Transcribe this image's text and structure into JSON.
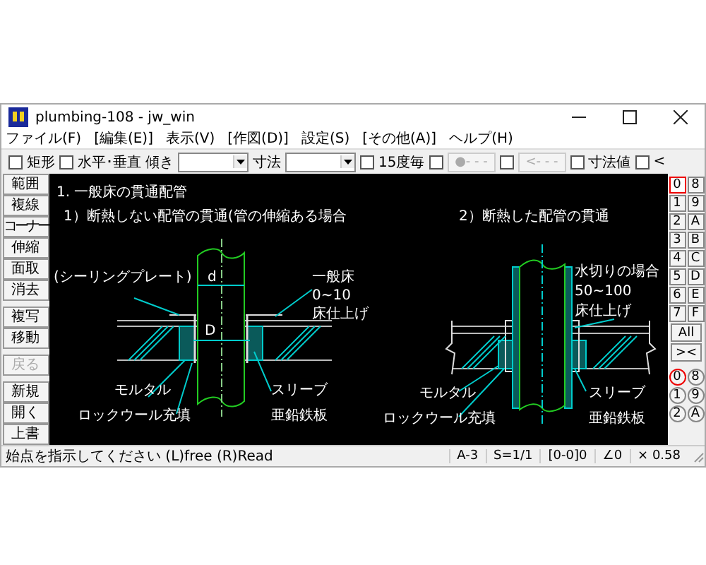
{
  "window": {
    "title": "plumbing-108 - jw_win"
  },
  "menu": [
    "ファイル(F)",
    "[編集(E)]",
    "表示(V)",
    "[作図(D)]",
    "設定(S)",
    "[その他(A)]",
    "ヘルプ(H)"
  ],
  "toolbar": [
    {
      "kind": "checkbox",
      "label": "矩形",
      "checked": false
    },
    {
      "kind": "checkbox",
      "label": "水平･垂直",
      "checked": false
    },
    {
      "kind": "combo",
      "label": "傾き"
    },
    {
      "kind": "combo",
      "label": "寸法"
    },
    {
      "kind": "checkbox",
      "label": "15度毎",
      "checked": false
    },
    {
      "kind": "checkbox",
      "checked": false
    },
    {
      "kind": "button",
      "label": "●- - -",
      "disabled": true
    },
    {
      "kind": "checkbox",
      "checked": false
    },
    {
      "kind": "button",
      "label": "<- - -",
      "disabled": true
    },
    {
      "kind": "checkbox",
      "label": "寸法値",
      "checked": false
    },
    {
      "kind": "checkbox",
      "label": "<",
      "checked": false
    }
  ],
  "left_tools": [
    {
      "label": "範囲",
      "disabled": false
    },
    {
      "label": "複線",
      "disabled": false
    },
    {
      "label": "コーナー",
      "disabled": false
    },
    {
      "label": "伸縮",
      "disabled": false
    },
    {
      "label": "面取",
      "disabled": false
    },
    {
      "label": "消去",
      "disabled": false
    },
    {
      "label": "複写",
      "disabled": false
    },
    {
      "label": "移動",
      "disabled": false
    },
    {
      "label": "戻る",
      "disabled": true
    },
    {
      "label": "新規",
      "disabled": false
    },
    {
      "label": "開く",
      "disabled": false
    },
    {
      "label": "上書",
      "disabled": false
    }
  ],
  "drawing": {
    "heading": "1. 一般床の貫通配管",
    "details": [
      {
        "title": "1）断熱しない配管の貫通(管の伸縮ある場合",
        "labels": [
          "(シーリングプレート)",
          "d",
          "一般床",
          "0~10",
          "床仕上げ",
          "D",
          "モルタル",
          "スリーブ",
          "ロックウール充填",
          "亜鉛鉄板"
        ]
      },
      {
        "title": "2）断熱した配管の貫通",
        "labels": [
          "水切りの場合",
          "50~100",
          "床仕上げ",
          "モルタル",
          "スリーブ",
          "ロックウール充填",
          "亜鉛鉄板"
        ]
      }
    ]
  },
  "layers": [
    {
      "label": "0",
      "selected": true
    },
    {
      "label": "8",
      "selected": false
    },
    {
      "label": "1",
      "selected": false
    },
    {
      "label": "9",
      "selected": false
    },
    {
      "label": "2",
      "selected": false
    },
    {
      "label": "A",
      "selected": false
    },
    {
      "label": "3",
      "selected": false
    },
    {
      "label": "B",
      "selected": false
    },
    {
      "label": "4",
      "selected": false
    },
    {
      "label": "C",
      "selected": false
    },
    {
      "label": "5",
      "selected": false
    },
    {
      "label": "D",
      "selected": false
    },
    {
      "label": "6",
      "selected": false
    },
    {
      "label": "E",
      "selected": false
    },
    {
      "label": "7",
      "selected": false
    },
    {
      "label": "F",
      "selected": false
    }
  ],
  "layer_tools": [
    "All",
    "><"
  ],
  "layer_groups": [
    {
      "label": "0",
      "selected": true
    },
    {
      "label": "8",
      "selected": false
    },
    {
      "label": "1",
      "selected": false
    },
    {
      "label": "9",
      "selected": false
    },
    {
      "label": "2",
      "selected": false
    },
    {
      "label": "A",
      "selected": false
    }
  ],
  "status_bar": {
    "message": "始点を指示してください (L)free (R)Read",
    "cells": [
      "A-3",
      "S=1/1",
      "[0-0]0",
      "∠0",
      "× 0.58"
    ]
  }
}
